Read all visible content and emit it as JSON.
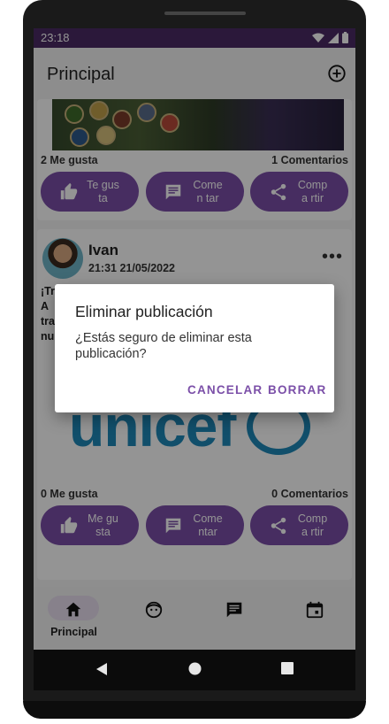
{
  "status": {
    "time": "23:18"
  },
  "appbar": {
    "title": "Principal",
    "add_icon": "add-circle-icon"
  },
  "post1": {
    "likes": "2 Me gusta",
    "comments": "1 Comentarios",
    "actions": [
      {
        "label": "Te gusta",
        "icon": "thumb-up-icon"
      },
      {
        "label": "Comen tar",
        "icon": "comment-icon"
      },
      {
        "label": "Compa rtir",
        "icon": "share-icon"
      }
    ]
  },
  "post2": {
    "author": "Ivan",
    "datetime": "21:31 21/05/2022",
    "text_lines": [
      "¡Tr",
      "A ",
      "tra",
      "nu"
    ],
    "image_text": "unicef",
    "likes": "0 Me gusta",
    "comments": "0 Comentarios",
    "actions": [
      {
        "label": "Me gusta",
        "icon": "thumb-up-icon"
      },
      {
        "label": "Come ntar",
        "icon": "comment-icon"
      },
      {
        "label": "Compa rtir",
        "icon": "share-icon"
      }
    ]
  },
  "bottomnav": {
    "home_label": "Principal",
    "items": [
      "home-icon",
      "face-icon",
      "chat-icon",
      "calendar-icon"
    ]
  },
  "dialog": {
    "title": "Eliminar publicación",
    "message": "¿Estás seguro de eliminar esta publicación?",
    "cancel": "CANCELAR",
    "confirm": "BORRAR"
  },
  "colors": {
    "accent": "#7b4fa8",
    "statusbar": "#4a2a64",
    "unicef": "#1e88b8"
  }
}
